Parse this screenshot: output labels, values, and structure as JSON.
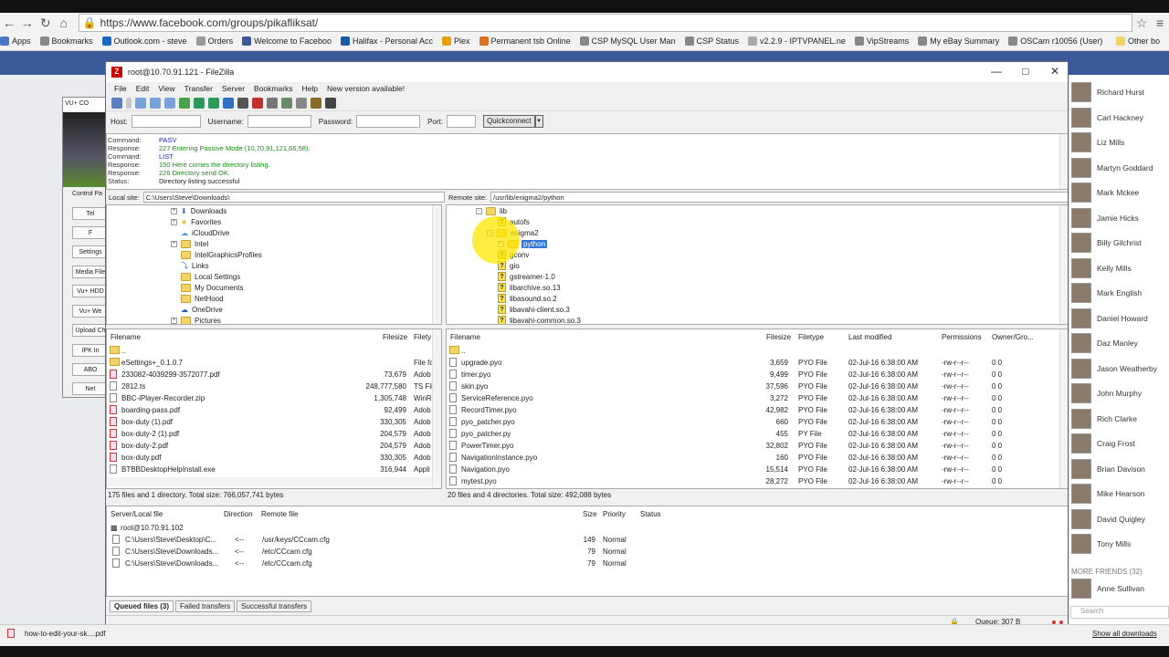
{
  "browser": {
    "url": "https://www.facebook.com/groups/pikafliksat/",
    "bookmarks": [
      "Apps",
      "Bookmarks",
      "Outlook.com - steve",
      "Orders",
      "Welcome to Faceboo",
      "Halifax - Personal Acc",
      "Plex",
      "Permanent tsb Online",
      "CSP MySQL User Man",
      "CSP Status",
      "v2.2.9 - IPTVPANEL.ne",
      "VipStreams",
      "My eBay Summary",
      "OSCam r10056 (User)"
    ],
    "other_bookmarks": "Other bo"
  },
  "vu_window": {
    "title": "VU+ CO",
    "control_panel": "Control Pa",
    "buttons": [
      "Tel",
      "F",
      "Settings",
      "Media File",
      "Vu+ HDD",
      "Vu+ We",
      "Upload Ch",
      "IPK In",
      "ABO",
      "Net"
    ]
  },
  "fz": {
    "title": "root@10.70.91.121 - FileZilla",
    "menu": [
      "File",
      "Edit",
      "View",
      "Transfer",
      "Server",
      "Bookmarks",
      "Help",
      "New version available!"
    ],
    "quickconnect": {
      "host_label": "Host:",
      "user_label": "Username:",
      "pass_label": "Password:",
      "port_label": "Port:",
      "button": "Quickconnect"
    },
    "log": [
      {
        "k": "Command:",
        "v": "PASV",
        "c": "#1a1ad0"
      },
      {
        "k": "Response:",
        "v": "227 Entering Passive Mode (10,70,91,121,66,58).",
        "c": "#1a8a1a"
      },
      {
        "k": "Command:",
        "v": "LIST",
        "c": "#1a1ad0"
      },
      {
        "k": "Response:",
        "v": "150 Here comes the directory listing.",
        "c": "#1a8a1a"
      },
      {
        "k": "Response:",
        "v": "226 Directory send OK.",
        "c": "#1a8a1a"
      },
      {
        "k": "Status:",
        "v": "Directory listing successful",
        "c": "#222"
      }
    ],
    "local": {
      "site_label": "Local site:",
      "path": "C:\\Users\\Steve\\Downloads\\",
      "tree": [
        "Downloads",
        "Favorites",
        "iCloudDrive",
        "Intel",
        "IntelGraphicsProfiles",
        "Links",
        "Local Settings",
        "My Documents",
        "NetHood",
        "OneDrive",
        "Pictures"
      ],
      "headers": [
        "Filename",
        "Filesize",
        "Filety"
      ],
      "files": [
        {
          "name": "..",
          "size": "",
          "type": ""
        },
        {
          "name": "eSettings+_0.1.0.7",
          "size": "",
          "type": "File fc"
        },
        {
          "name": "233082-4039299-3572077.pdf",
          "size": "73,679",
          "type": "Adob"
        },
        {
          "name": "2812.ts",
          "size": "248,777,580",
          "type": "TS Fil"
        },
        {
          "name": "BBC-iPlayer-Recorder.zip",
          "size": "1,305,748",
          "type": "WinR"
        },
        {
          "name": "boarding-pass.pdf",
          "size": "92,499",
          "type": "Adob"
        },
        {
          "name": "box-duty (1).pdf",
          "size": "330,305",
          "type": "Adob"
        },
        {
          "name": "box-duty-2 (1).pdf",
          "size": "204,579",
          "type": "Adob"
        },
        {
          "name": "box-duty-2.pdf",
          "size": "204,579",
          "type": "Adob"
        },
        {
          "name": "box-duty.pdf",
          "size": "330,305",
          "type": "Adob"
        },
        {
          "name": "BTBBDesktopHelpInstall.exe",
          "size": "316,944",
          "type": "Appli"
        }
      ],
      "summary": "175 files and 1 directory. Total size: 766,057,741 bytes"
    },
    "remote": {
      "site_label": "Remote site:",
      "path": "/usr/lib/enigma2/python",
      "tree": [
        "lib",
        "autofs",
        "enigma2",
        "python",
        "gconv",
        "gio",
        "gstreamer-1.0",
        "libarchive.so.13",
        "libasound.so.2",
        "libavahi-client.so.3",
        "libavahi-common.so.3"
      ],
      "headers": [
        "Filename",
        "Filesize",
        "Filetype",
        "Last modified",
        "Permissions",
        "Owner/Gro..."
      ],
      "files": [
        {
          "name": "..",
          "size": "",
          "type": "",
          "mod": "",
          "perm": "",
          "owner": ""
        },
        {
          "name": "upgrade.pyo",
          "size": "3,659",
          "type": "PYO File",
          "mod": "02-Jul-16 6:38:00 AM",
          "perm": "-rw-r--r--",
          "owner": "0 0"
        },
        {
          "name": "timer.pyo",
          "size": "9,499",
          "type": "PYO File",
          "mod": "02-Jul-16 6:38:00 AM",
          "perm": "-rw-r--r--",
          "owner": "0 0"
        },
        {
          "name": "skin.pyo",
          "size": "37,596",
          "type": "PYO File",
          "mod": "02-Jul-16 6:38:00 AM",
          "perm": "-rw-r--r--",
          "owner": "0 0"
        },
        {
          "name": "ServiceReference.pyo",
          "size": "3,272",
          "type": "PYO File",
          "mod": "02-Jul-16 6:38:00 AM",
          "perm": "-rw-r--r--",
          "owner": "0 0"
        },
        {
          "name": "RecordTimer.pyo",
          "size": "42,982",
          "type": "PYO File",
          "mod": "02-Jul-16 6:38:00 AM",
          "perm": "-rw-r--r--",
          "owner": "0 0"
        },
        {
          "name": "pyo_patcher.pyo",
          "size": "660",
          "type": "PYO File",
          "mod": "02-Jul-16 6:38:00 AM",
          "perm": "-rw-r--r--",
          "owner": "0 0"
        },
        {
          "name": "pyo_patcher.py",
          "size": "455",
          "type": "PY File",
          "mod": "02-Jul-16 6:38:00 AM",
          "perm": "-rw-r--r--",
          "owner": "0 0"
        },
        {
          "name": "PowerTimer.pyo",
          "size": "32,802",
          "type": "PYO File",
          "mod": "02-Jul-16 6:38:00 AM",
          "perm": "-rw-r--r--",
          "owner": "0 0"
        },
        {
          "name": "NavigationInstance.pyo",
          "size": "160",
          "type": "PYO File",
          "mod": "02-Jul-16 6:38:00 AM",
          "perm": "-rw-r--r--",
          "owner": "0 0"
        },
        {
          "name": "Navigation.pyo",
          "size": "15,514",
          "type": "PYO File",
          "mod": "02-Jul-16 6:38:00 AM",
          "perm": "-rw-r--r--",
          "owner": "0 0"
        },
        {
          "name": "mytest.pyo",
          "size": "28,272",
          "type": "PYO File",
          "mod": "02-Jul-16 6:38:00 AM",
          "perm": "-rw-r--r--",
          "owner": "0 0"
        }
      ],
      "summary": "20 files and 4 directories. Total size: 492,088 bytes"
    },
    "queue": {
      "headers": [
        "Server/Local file",
        "Direction",
        "Remote file",
        "Size",
        "Priority",
        "Status"
      ],
      "server": "root@10.70.91.102",
      "items": [
        {
          "local": "C:\\Users\\Steve\\Desktop\\C...",
          "dir": "<--",
          "remote": "/usr/keys/CCcam.cfg",
          "size": "149",
          "prio": "Normal"
        },
        {
          "local": "C:\\Users\\Steve\\Downloads...",
          "dir": "<--",
          "remote": "/etc/CCcam.cfg",
          "size": "79",
          "prio": "Normal"
        },
        {
          "local": "C:\\Users\\Steve\\Downloads...",
          "dir": "<--",
          "remote": "/etc/CCcam.cfg",
          "size": "79",
          "prio": "Normal"
        }
      ],
      "tabs": [
        "Queued files (3)",
        "Failed transfers",
        "Successful transfers"
      ],
      "status": "Queue: 307 B"
    }
  },
  "fb": {
    "friends": [
      "Richard Hurst",
      "Carl Hackney",
      "Liz Mills",
      "Martyn Goddard",
      "Mark Mckee",
      "Jamie Hicks",
      "Billy Gilchrist",
      "Kelly Mills",
      "Mark English",
      "Daniel Howard",
      "Daz Manley",
      "Jason Weatherby",
      "John Murphy",
      "Rich Clarke",
      "Craig Frost",
      "Brian Davison",
      "Mike Hearson",
      "David Quigley",
      "Tony Mills"
    ],
    "more_friends": "MORE FRIENDS (32)",
    "extra_friend": "Anne Sullivan",
    "search_placeholder": "Search",
    "download_file": "how-to-edit-your-sk....pdf",
    "show_all": "Show all downloads"
  }
}
